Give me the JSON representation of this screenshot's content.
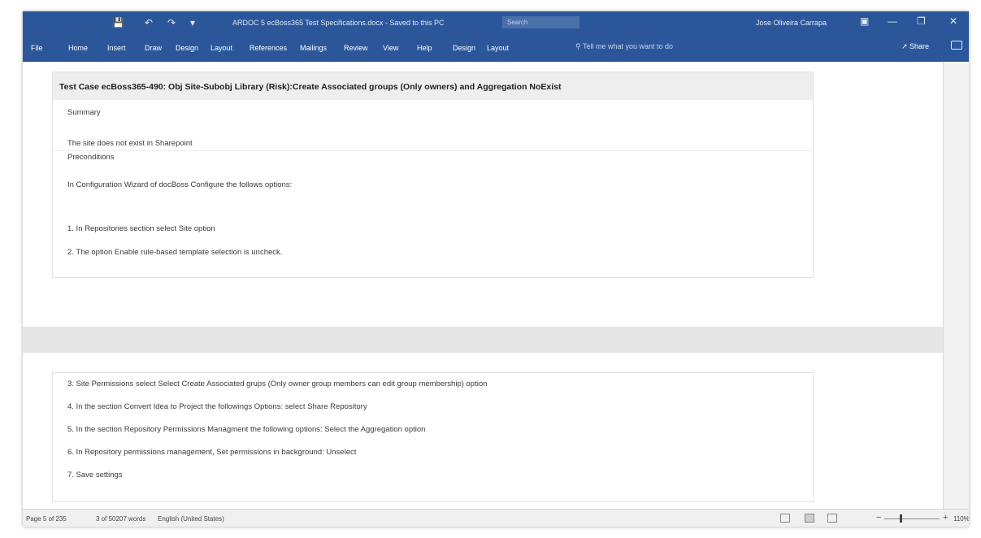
{
  "titlebar": {
    "document_title": "ARDOC 5 ecBoss365 Test Specifications.docx - Saved to this PC",
    "search_placeholder": "Search",
    "user_name": "Jose Oliveira Carrapa",
    "autosave_icon": "save-icon",
    "undo_icon": "undo-icon",
    "redo_icon": "redo-icon"
  },
  "ribbon": {
    "tabs": [
      "File",
      "Home",
      "Insert",
      "Draw",
      "Design",
      "Layout",
      "References",
      "Mailings",
      "Review",
      "View",
      "Help",
      "Design",
      "Layout"
    ],
    "tell_me": "Tell me what you want to do",
    "share_label": "Share"
  },
  "document": {
    "table1": {
      "header": "Test Case ecBoss365-490: Obj Site-Subobj Library (Risk):Create Associated groups (Only owners) and Aggregation NoExist",
      "summary_label": "Summary",
      "summary_text": "The site does not exist in Sharepoint",
      "preconditions_label": "Preconditions",
      "precondition_intro": "In Configuration Wizard of docBoss Configure the follows options:",
      "steps": [
        "1. In Repositories section select Site option",
        "2. The option Enable rule-based template selection is uncheck."
      ]
    },
    "table2": {
      "steps": [
        "3. Site Permissions select Select Create Associated grups (Only owner group members can edit group membership) option",
        "4. In the section Convert Idea to Project the followings Options: select Share Repository",
        "5. In the section Repository Permissions Managment the following options: Select the Aggregation option",
        "6. In Repository permissions management, Set permissions in background: Unselect",
        "7. Save settings"
      ]
    }
  },
  "statusbar": {
    "page": "Page 5 of 235",
    "words": "3 of 50207 words",
    "language": "English (United States)",
    "zoom": "110%",
    "zoom_fraction": 0.3
  },
  "colors": {
    "ribbon": "#2b579a",
    "page": "#ffffff",
    "workspace": "#e6e6e6"
  }
}
